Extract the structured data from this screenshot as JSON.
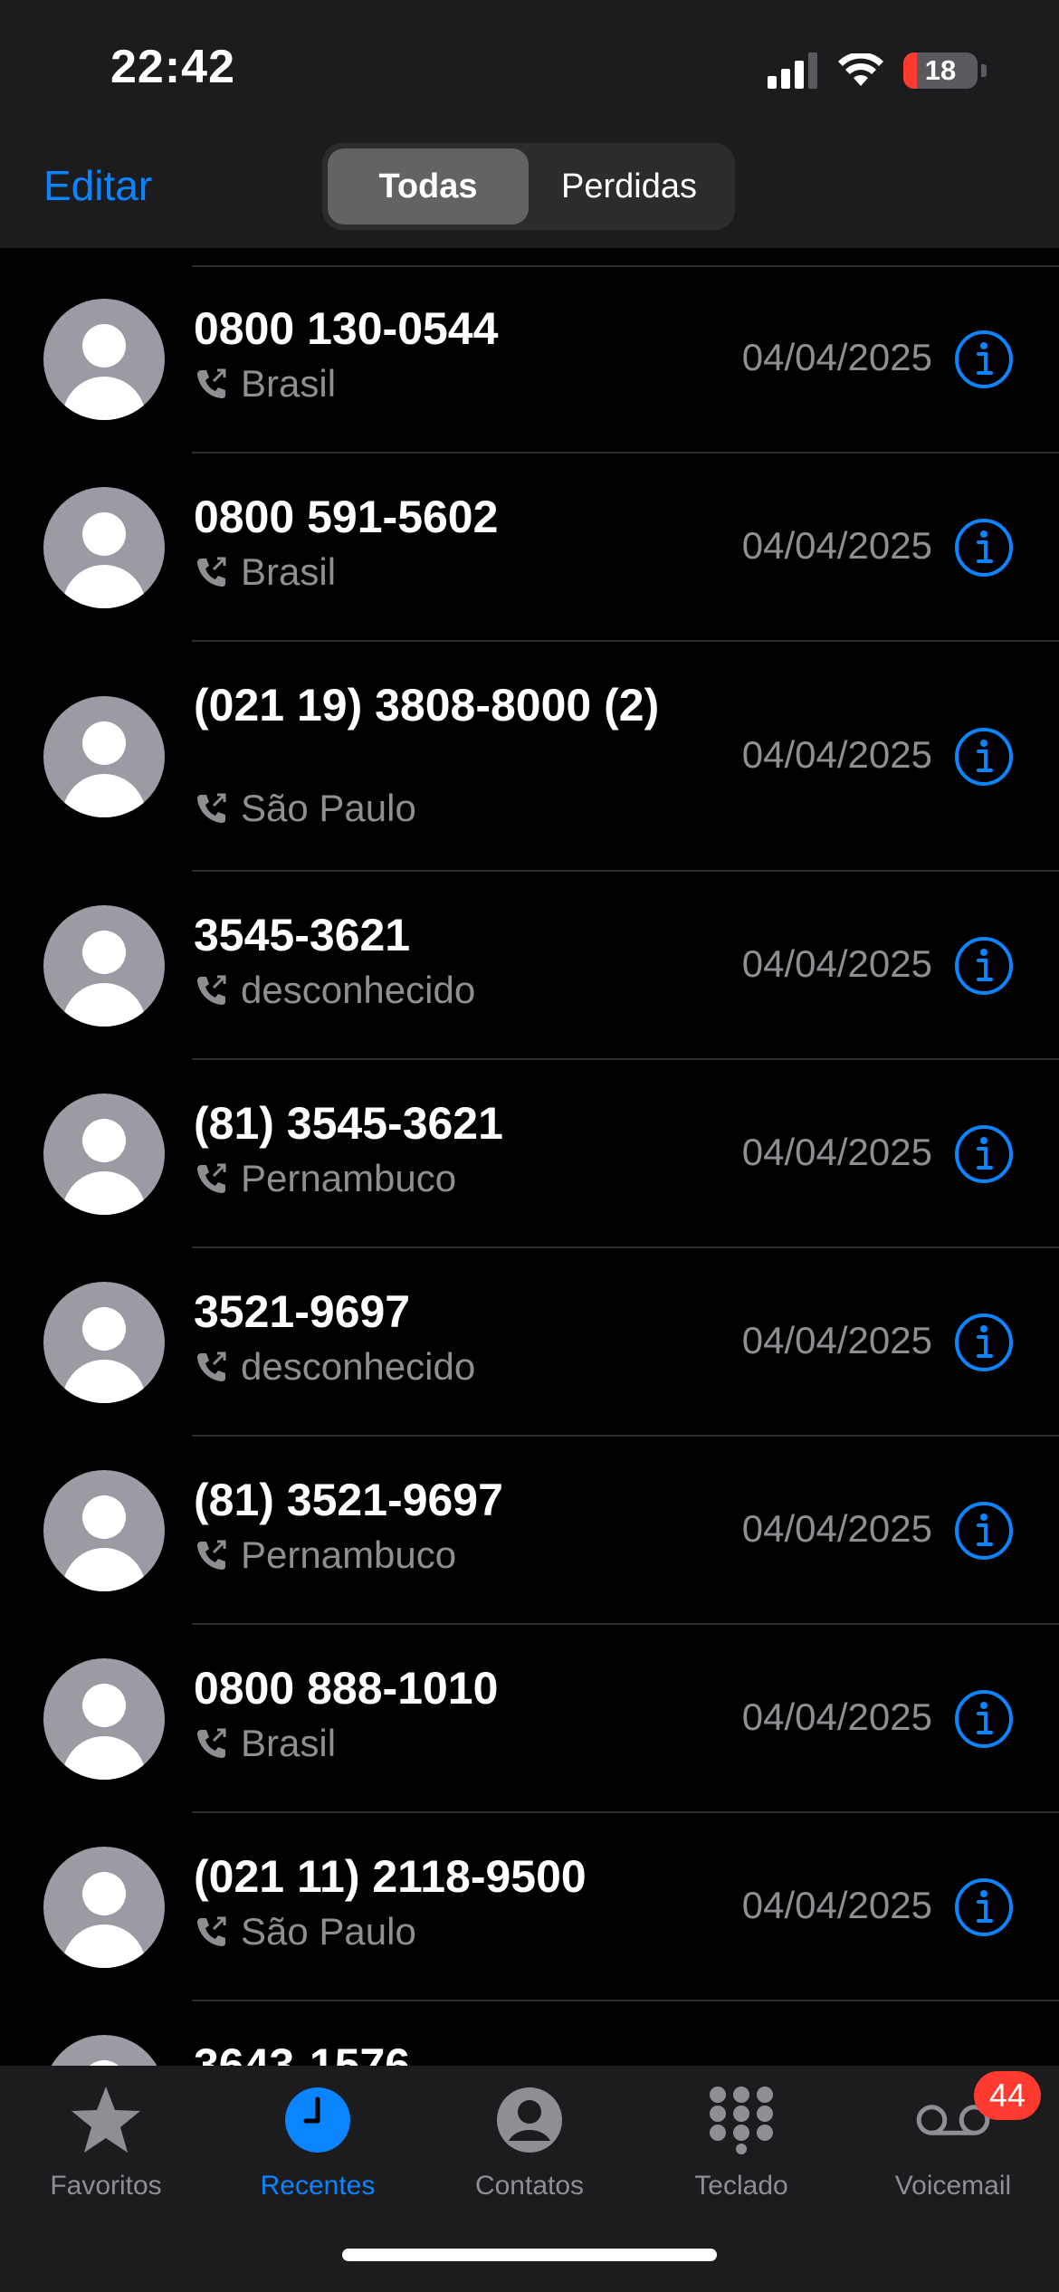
{
  "status_bar": {
    "time": "22:42",
    "battery": "18",
    "battery_level": 0.18,
    "battery_color": "#ff3b30"
  },
  "header": {
    "edit_label": "Editar",
    "segments": [
      {
        "label": "Todas",
        "active": true
      },
      {
        "label": "Perdidas",
        "active": false
      }
    ]
  },
  "accent_color": "#0a84ff",
  "calls": [
    {
      "number": "0800 130-0544",
      "location": "Brasil",
      "date": "04/04/2025"
    },
    {
      "number": "0800 591-5602",
      "location": "Brasil",
      "date": "04/04/2025"
    },
    {
      "number": "(021 19) 3808-8000 (2)",
      "location": "São Paulo",
      "date": "04/04/2025"
    },
    {
      "number": "3545-3621",
      "location": "desconhecido",
      "date": "04/04/2025"
    },
    {
      "number": "(81) 3545-3621",
      "location": "Pernambuco",
      "date": "04/04/2025"
    },
    {
      "number": "3521-9697",
      "location": "desconhecido",
      "date": "04/04/2025"
    },
    {
      "number": "(81) 3521-9697",
      "location": "Pernambuco",
      "date": "04/04/2025"
    },
    {
      "number": "0800 888-1010",
      "location": "Brasil",
      "date": "04/04/2025"
    },
    {
      "number": "(021 11) 2118-9500",
      "location": "São Paulo",
      "date": "04/04/2025"
    },
    {
      "number": "3643-1576",
      "location": "",
      "date": ""
    }
  ],
  "tabs": [
    {
      "label": "Favoritos",
      "icon": "star-icon",
      "active": false
    },
    {
      "label": "Recentes",
      "icon": "clock-icon",
      "active": true
    },
    {
      "label": "Contatos",
      "icon": "contact-icon",
      "active": false
    },
    {
      "label": "Teclado",
      "icon": "keypad-icon",
      "active": false
    },
    {
      "label": "Voicemail",
      "icon": "voicemail-icon",
      "active": false
    }
  ],
  "voicemail_badge": "44"
}
